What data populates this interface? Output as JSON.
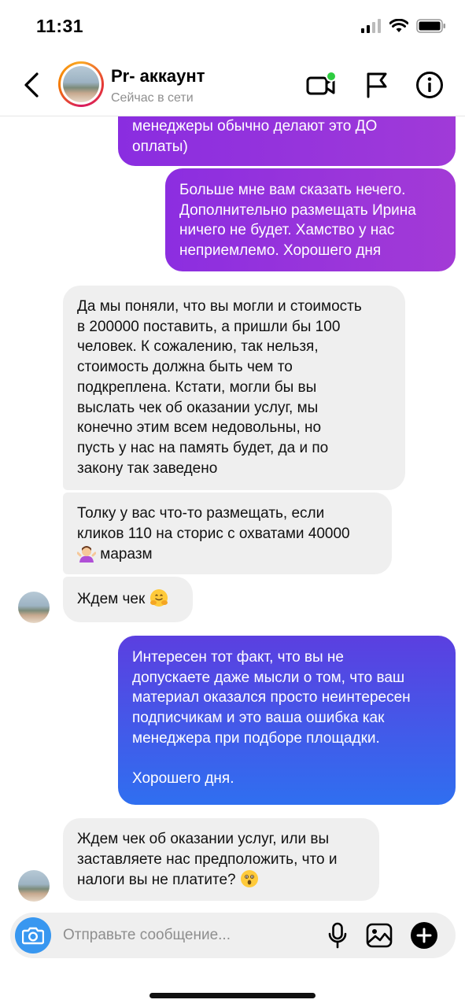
{
  "status_bar": {
    "time": "11:31"
  },
  "header": {
    "title": "Pr- аккаунт",
    "subtitle": "Сейчас в сети",
    "back_icon": "chevron-left-icon",
    "video_icon": "video-call-icon",
    "flag_icon": "flag-icon",
    "info_icon": "info-icon"
  },
  "messages": [
    {
      "side": "out",
      "text": "менеджеры обычно делают это ДО\nоплаты)"
    },
    {
      "side": "out",
      "text": "Больше мне вам сказать нечего.\nДополнительно размещать Ирина\nничего не будет. Хамство у нас\nнеприемлемо. Хорошего дня"
    },
    {
      "side": "in",
      "text": "Да мы поняли, что вы могли и стоимость\nв 200000 поставить, а пришли бы 100\nчеловек. К сожалению, так нельзя,\nстоимость должна быть чем то\nподкреплена. Кстати, могли бы вы\nвыслать чек об оказании услуг, мы\nконечно этим всем недовольны, но\nпусть у нас на память будет, да и по\nзакону так заведено"
    },
    {
      "side": "in",
      "text_a": "Толку у вас что-то размещать, если\nкликов 110 на сторис с охватами 40000",
      "text_b": " маразм",
      "emoji": "shrugging-woman-emoji"
    },
    {
      "side": "in",
      "text": "Ждем чек ",
      "emoji": "hugging-face-emoji"
    },
    {
      "side": "out",
      "text": "Интересен тот факт, что вы не\nдопускаете даже мысли о том, что ваш\nматериал оказался просто неинтересен\nподписчикам и это ваша ошибка как\nменеджера при подборе площадки.\n\nХорошего дня."
    },
    {
      "side": "in",
      "text": "Ждем чек об оказании услуг, или вы\nзаставляете нас предположить, что и\nналоги вы не платите? ",
      "emoji": "astonished-face-emoji"
    }
  ],
  "composer": {
    "placeholder": "Отправьте сообщение...",
    "camera_icon": "camera-icon",
    "mic_icon": "microphone-icon",
    "gallery_icon": "gallery-icon",
    "plus_icon": "plus-icon"
  },
  "colors": {
    "outgoing_purple": "#8e2de2",
    "outgoing_purple_end": "#a437db",
    "outgoing_blue_start": "#5b3fe0",
    "outgoing_blue_end": "#2f6ff0",
    "incoming_bg": "#efefef",
    "camera_blue": "#3897f0",
    "online_dot": "#2ecc40"
  }
}
